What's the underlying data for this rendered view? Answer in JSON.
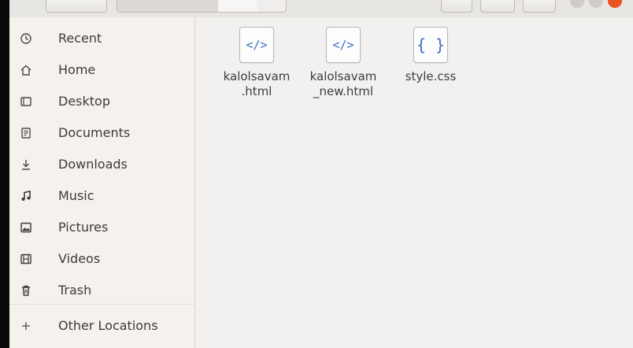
{
  "sidebar": {
    "items": [
      {
        "label": "Recent",
        "icon": "clock-icon"
      },
      {
        "label": "Home",
        "icon": "home-icon"
      },
      {
        "label": "Desktop",
        "icon": "desktop-icon"
      },
      {
        "label": "Documents",
        "icon": "document-icon"
      },
      {
        "label": "Downloads",
        "icon": "download-icon"
      },
      {
        "label": "Music",
        "icon": "music-icon"
      },
      {
        "label": "Pictures",
        "icon": "picture-icon"
      },
      {
        "label": "Videos",
        "icon": "film-icon"
      },
      {
        "label": "Trash",
        "icon": "trash-icon"
      }
    ],
    "other_locations": {
      "label": "Other Locations",
      "icon": "plus-icon"
    }
  },
  "files": [
    {
      "name": "kalolsavam\n.html",
      "icon_glyph": "</>",
      "type": "html"
    },
    {
      "name": "kalolsavam\n_new.html",
      "icon_glyph": "</>",
      "type": "html"
    },
    {
      "name": "style.css",
      "icon_glyph": "{ }",
      "type": "css"
    }
  ],
  "colors": {
    "sidebar_bg": "#f5f1ed",
    "content_bg": "#f2f1f0",
    "file_icon_accent": "#3d6fc4",
    "close_button": "#e95420"
  }
}
